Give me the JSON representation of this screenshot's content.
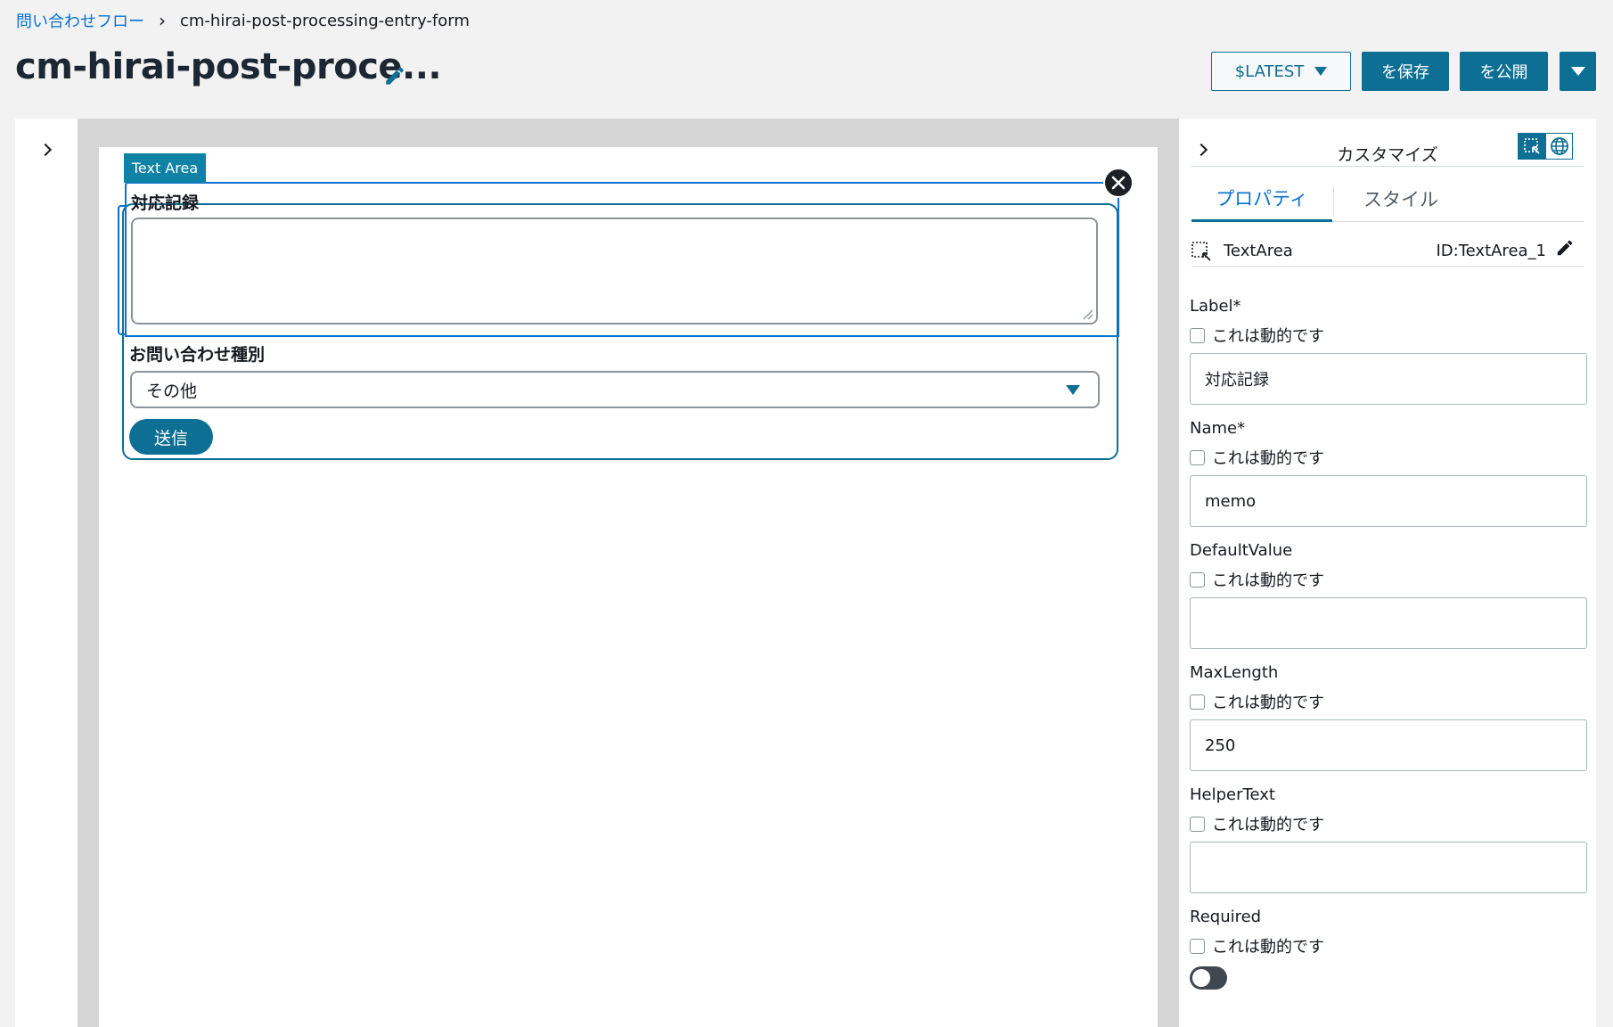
{
  "breadcrumb": {
    "parent": "問い合わせフロー",
    "current": "cm-hirai-post-processing-entry-form"
  },
  "header": {
    "title": "cm-hirai-post-proce...",
    "version_label": "$LATEST",
    "save_label": "を保存",
    "publish_label": "を公開"
  },
  "canvas": {
    "selected_tag": "Text Area",
    "textarea_label": "対応記録",
    "textarea_value": "",
    "select_label": "お問い合わせ種別",
    "select_value": "その他",
    "submit_label": "送信"
  },
  "customize": {
    "title": "カスタマイズ",
    "tabs": {
      "properties": "プロパティ",
      "style": "スタイル"
    },
    "component": {
      "type": "TextArea",
      "id": "ID:TextArea_1"
    },
    "dynamic_label": "これは動的です",
    "props": [
      {
        "label": "Label*",
        "value": "対応記録"
      },
      {
        "label": "Name*",
        "value": "memo"
      },
      {
        "label": "DefaultValue",
        "value": ""
      },
      {
        "label": "MaxLength",
        "value": "250"
      },
      {
        "label": "HelperText",
        "value": ""
      },
      {
        "label": "Required",
        "value": ""
      }
    ]
  },
  "colors": {
    "accent": "#0d6f94",
    "link": "#0972d3",
    "selection": "#0972d3"
  }
}
